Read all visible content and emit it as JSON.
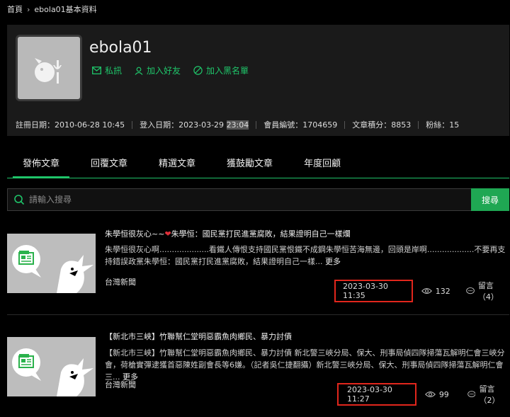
{
  "breadcrumb": {
    "home": "首頁",
    "current": "ebola01基本資料"
  },
  "profile": {
    "username": "ebola01",
    "actions": {
      "message": "私訊",
      "add_friend": "加入好友",
      "blacklist": "加入黑名單"
    },
    "stats": {
      "registered": "註冊日期：2010-06-28 10:45",
      "login_prefix": "登入日期：2023-03-29 ",
      "login_time_hl": "23:04",
      "member_no": "會員編號：1704659",
      "points": "文章積分：8853",
      "fans": "粉絲：15"
    }
  },
  "tabs": [
    {
      "label": "發佈文章",
      "active": true
    },
    {
      "label": "回覆文章",
      "active": false
    },
    {
      "label": "精選文章",
      "active": false
    },
    {
      "label": "獲鼓勵文章",
      "active": false
    },
    {
      "label": "年度回顧",
      "active": false
    }
  ],
  "search": {
    "placeholder": "請輸入搜尋",
    "button": "搜尋"
  },
  "articles": [
    {
      "title_a": "朱學恒很灰心~~",
      "title_b": "朱學恒：國民黨打民進黨腐敗，結果證明自己一樣爛",
      "excerpt": "朱學恒很灰心啊....................看鐵人傳恨支持國民黨恨鐵不成鋼朱學恒苦海無邊，回頭是岸啊...................不要再支持錯誤政黨朱學恒：國民黨打民進黨腐敗，結果證明自己一樣...",
      "more": "更多",
      "source": "台灣新聞",
      "time": "2023-03-30 11:35",
      "views": "132",
      "comments": "留言（4）"
    },
    {
      "title": "【新北市三峽】竹聯幫仁堂明惡霸魚肉鄉民、暴力討債",
      "excerpt": "【新北市三峽】竹聯幫仁堂明惡霸魚肉鄉民、暴力討債 新北警三峽分局、保大、刑事局偵四隊掃蕩瓦解明仁會三峽分會，荷槍實彈逮獲首惡陳姓副會長等6嫌。（記者吳仁捷翻攝）新北警三峽分局、保大、刑事局偵四隊掃蕩瓦解明仁會三...",
      "more": "更多",
      "source": "台灣新聞",
      "time": "2023-03-30 11:27",
      "views": "99",
      "comments": "留言（2）"
    }
  ],
  "colors": {
    "accent": "#1fc56a",
    "search_button": "#1fa753",
    "highlight_box": "#e1261c",
    "heart": "#e0303a"
  },
  "icons": [
    "message-icon",
    "add-user-icon",
    "block-icon",
    "search-icon",
    "eye-icon",
    "comment-icon",
    "news-icon",
    "default-avatar-icon"
  ]
}
